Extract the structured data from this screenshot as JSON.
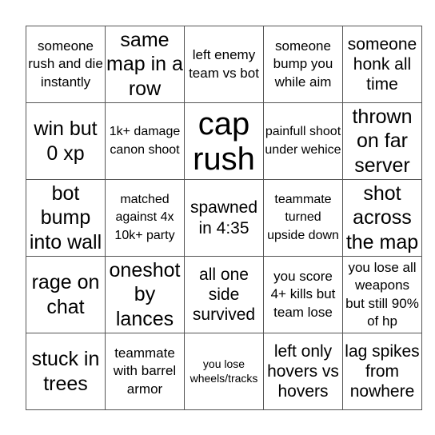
{
  "board": {
    "rows": [
      [
        {
          "text": "someone rush and die instantly",
          "size": "s"
        },
        {
          "text": "same map in a row",
          "size": "l"
        },
        {
          "text": "left enemy team vs bot",
          "size": "s"
        },
        {
          "text": "someone bump you while aim",
          "size": "s"
        },
        {
          "text": "someone honk all time",
          "size": "m"
        }
      ],
      [
        {
          "text": "win but 0 xp",
          "size": "l"
        },
        {
          "text": "1k+ damage canon shoot",
          "size": "xs"
        },
        {
          "text": "cap rush",
          "size": "xl"
        },
        {
          "text": "painfull shoot under wehice",
          "size": "xs"
        },
        {
          "text": "thrown on far server",
          "size": "l"
        }
      ],
      [
        {
          "text": "bot bump into wall",
          "size": "l"
        },
        {
          "text": "matched against 4x 10k+ party",
          "size": "xs"
        },
        {
          "text": "spawned in 4:35",
          "size": "m"
        },
        {
          "text": "teammate turned upside down",
          "size": "xs"
        },
        {
          "text": "shot across the map",
          "size": "l"
        }
      ],
      [
        {
          "text": "rage on chat",
          "size": "l"
        },
        {
          "text": "oneshot by lances",
          "size": "l"
        },
        {
          "text": "all one side survived",
          "size": "m"
        },
        {
          "text": "you score 4+ kills but team lose",
          "size": "s"
        },
        {
          "text": "you lose all weapons but still 90% of hp",
          "size": "s"
        }
      ],
      [
        {
          "text": "stuck in trees",
          "size": "l"
        },
        {
          "text": "teammate with barrel armor",
          "size": "s"
        },
        {
          "text": "you lose wheels/tracks",
          "size": "xxs"
        },
        {
          "text": "left only hovers vs hovers",
          "size": "m"
        },
        {
          "text": "lag spikes from nowhere",
          "size": "m"
        }
      ]
    ]
  }
}
